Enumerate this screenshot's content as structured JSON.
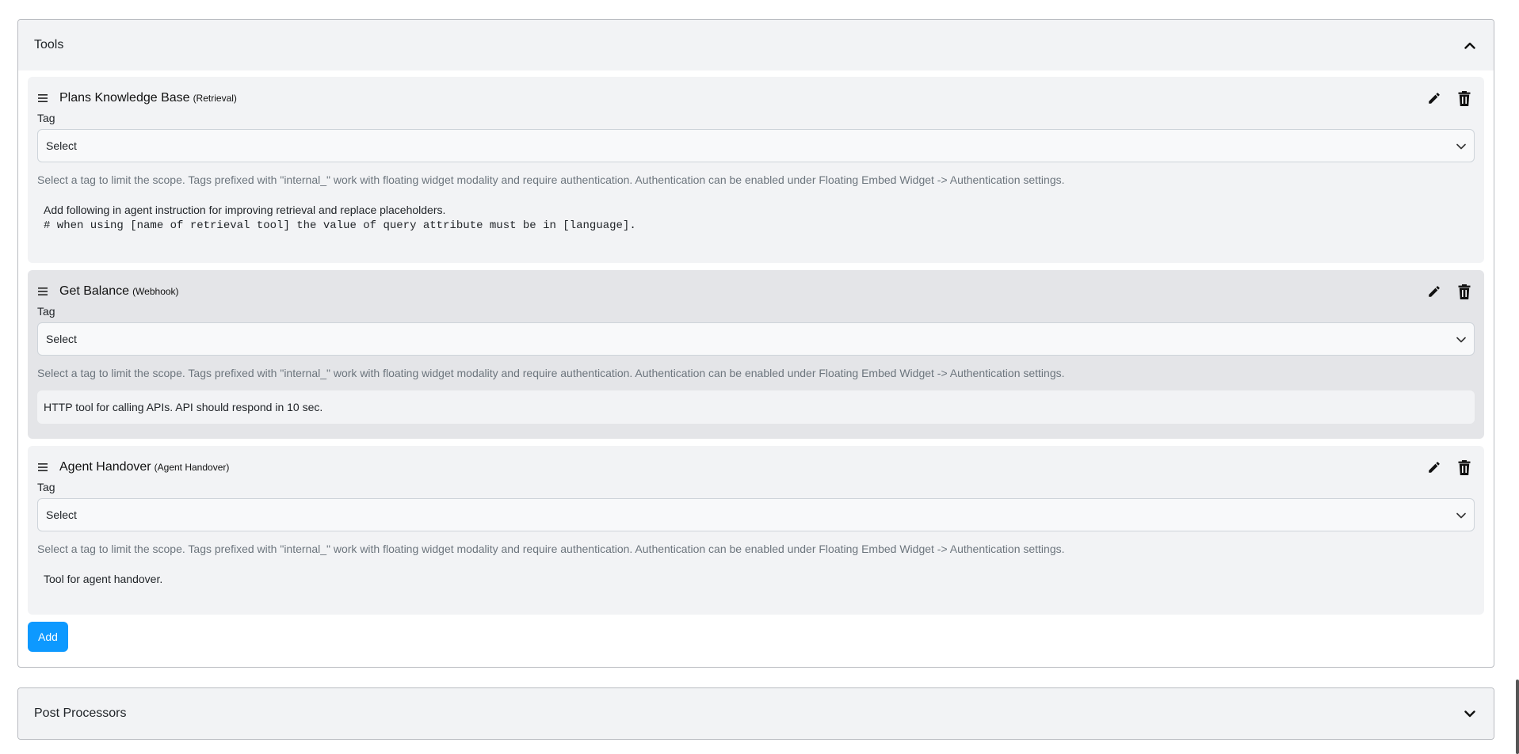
{
  "tools_panel": {
    "title": "Tools",
    "tools": [
      {
        "name": "Plans Knowledge Base",
        "type": "(Retrieval)",
        "tag_label": "Tag",
        "tag_value": "Select",
        "help": "Select a tag to limit the scope. Tags prefixed with \"internal_\" work with floating widget modality and require authentication. Authentication can be enabled under Floating Embed Widget -> Authentication settings.",
        "info_line1": "Add following in agent instruction for improving retrieval and replace placeholders.",
        "info_line2": "# when using [name of retrieval tool] the value of query attribute must be in [language]."
      },
      {
        "name": "Get Balance",
        "type": "(Webhook)",
        "tag_label": "Tag",
        "tag_value": "Select",
        "help": "Select a tag to limit the scope. Tags prefixed with \"internal_\" work with floating widget modality and require authentication. Authentication can be enabled under Floating Embed Widget -> Authentication settings.",
        "info": "HTTP tool for calling APIs. API should respond in 10 sec."
      },
      {
        "name": "Agent Handover",
        "type": "(Agent Handover)",
        "tag_label": "Tag",
        "tag_value": "Select",
        "help": "Select a tag to limit the scope. Tags prefixed with \"internal_\" work with floating widget modality and require authentication. Authentication can be enabled under Floating Embed Widget -> Authentication settings.",
        "info": "Tool for agent handover."
      }
    ],
    "add_label": "Add"
  },
  "post_processors_panel": {
    "title": "Post Processors"
  },
  "icons": {
    "drag": "drag-handle-icon",
    "edit": "pencil-icon",
    "delete": "trash-icon",
    "collapse": "chevron-up-icon",
    "expand": "chevron-down-icon"
  },
  "colors": {
    "accent": "#0d99ff",
    "card_bg": "#f2f3f5",
    "card_active_bg": "#e4e5e8",
    "help_text": "#6c757d"
  }
}
